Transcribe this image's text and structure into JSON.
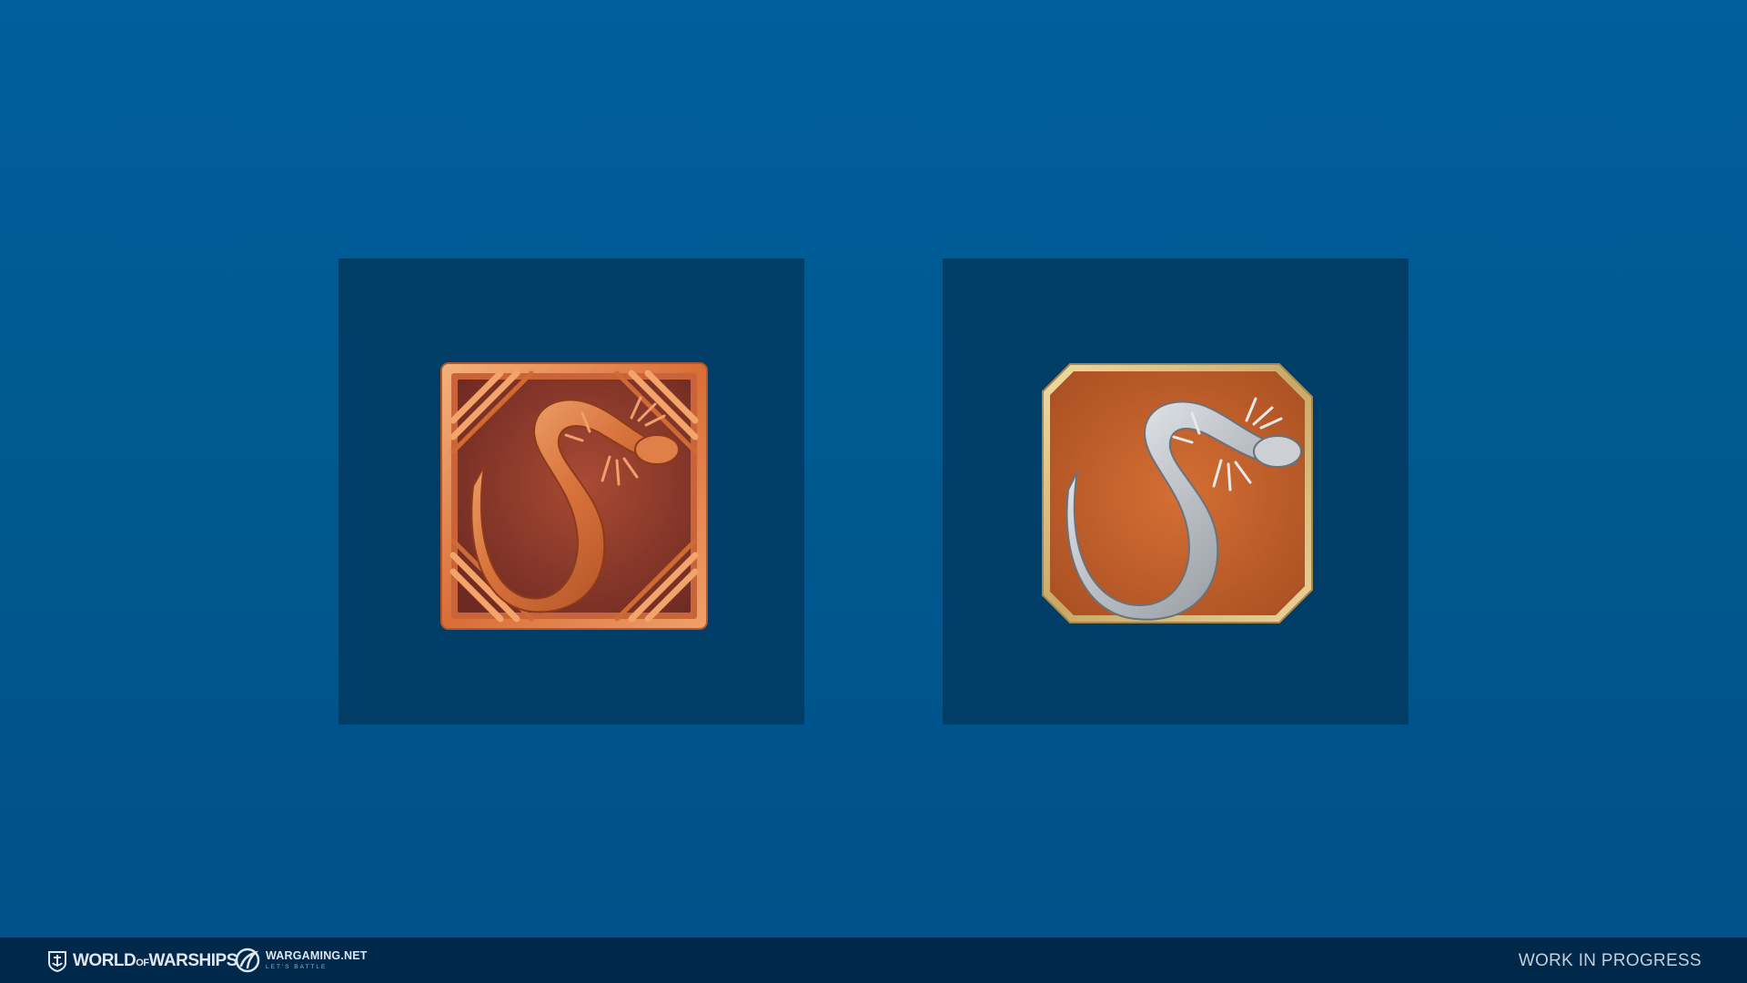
{
  "panels": [
    {
      "name": "bronze-salamander-emblem",
      "icon": "salamander-icon",
      "frame_icon": "rope-corner-icon",
      "metal": "bronze",
      "colors": {
        "frame": "#e07840",
        "field": "#8a3a28",
        "creature": "#d8763e"
      }
    },
    {
      "name": "silver-salamander-emblem",
      "icon": "salamander-icon",
      "metal": "silver",
      "colors": {
        "frame": "#d8b878",
        "field": "#c0602a",
        "creature": "#c8ccd0"
      }
    }
  ],
  "footer": {
    "game_logo_icon": "anchor-shield-icon",
    "game_logo_text": {
      "world": "WORLD",
      "of": "OF",
      "warships": "WARSHIPS"
    },
    "publisher_logo_icon": "wargaming-swirl-icon",
    "publisher_name": "WARGAMING.NET",
    "publisher_slogan": "LET'S BATTLE",
    "status": "WORK IN PROGRESS"
  },
  "colors": {
    "background": "#005a92",
    "panel": "#003d67",
    "footer": "#00284a"
  }
}
